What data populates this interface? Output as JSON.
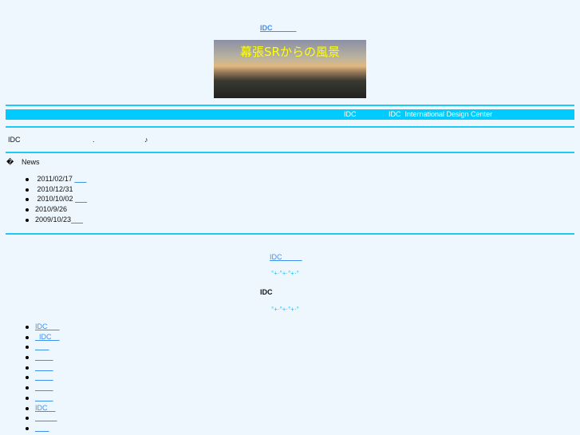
{
  "header": {
    "top_link": "IDC            ",
    "banner_text": "幕張SRからの風景"
  },
  "bar": {
    "left": "IDC",
    "right": "IDC  International Design Center"
  },
  "intro": {
    "a": "IDC",
    "b": ".",
    "c": "♪"
  },
  "news": {
    "icon": "�",
    "title": "News",
    "items": [
      {
        "date": " 2011/02/17 ",
        "link": "      "
      },
      {
        "date": " 2010/12/31",
        "link": ""
      },
      {
        "date": " 2010/10/02 ",
        "link": "      "
      },
      {
        "date": "2010/9/26",
        "link": ""
      },
      {
        "date": "2009/10/23",
        "link": "      "
      }
    ]
  },
  "center": {
    "link": "IDC          ",
    "deco": "°+·°+·°+·°",
    "heading": "IDC",
    "deco2": "°+·°+·°+·°"
  },
  "links": [
    "IDC      ",
    "  IDC    ",
    "       ",
    "         ",
    "         ",
    "         ",
    "         ",
    "         ",
    "IDC    ",
    "           ",
    "       "
  ]
}
